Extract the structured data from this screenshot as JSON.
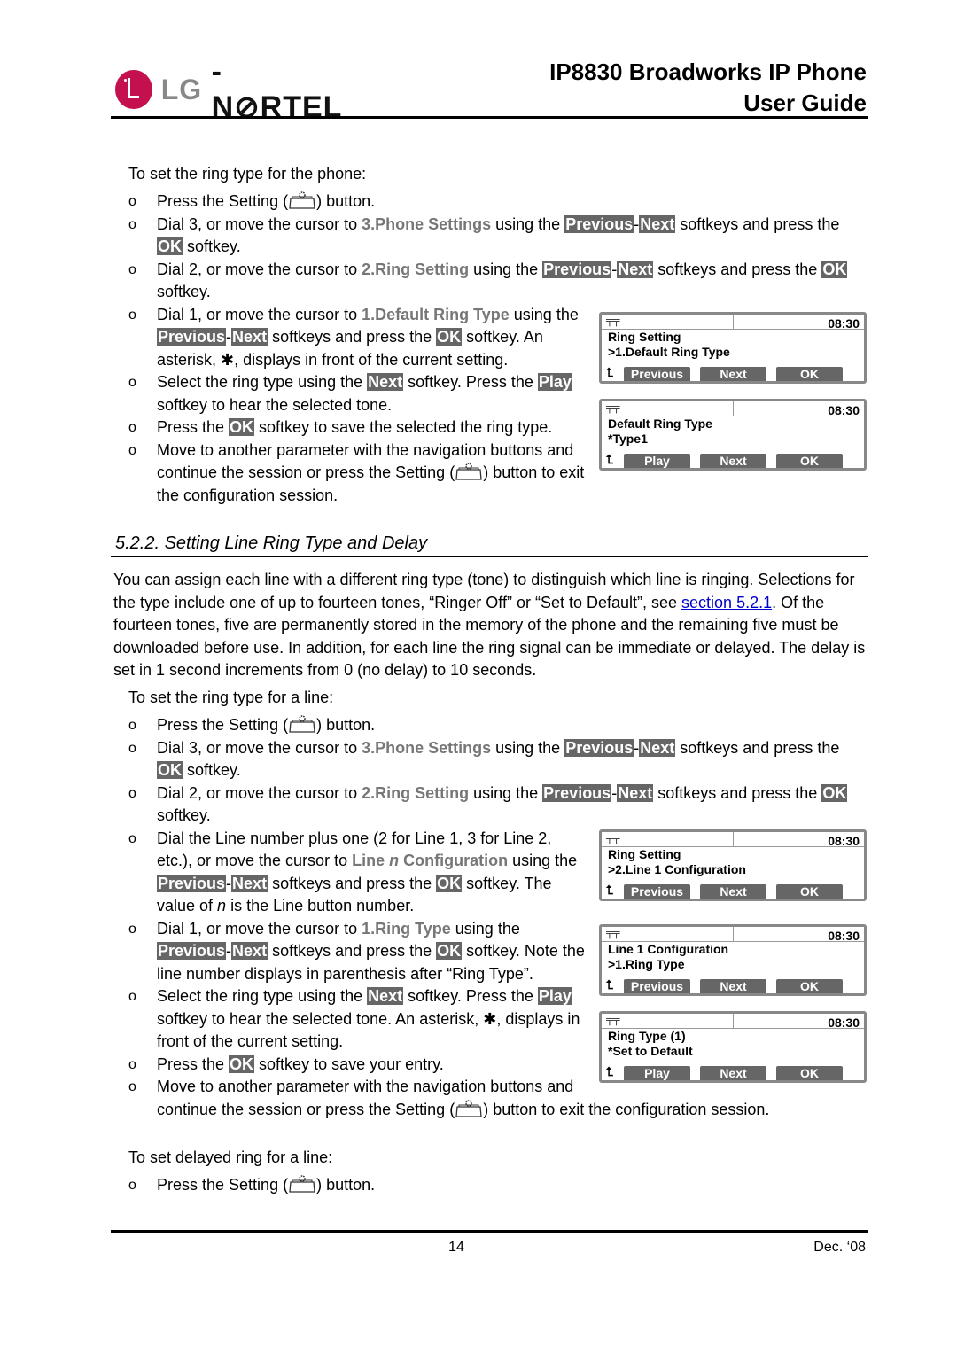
{
  "header": {
    "logo_text": "LG-NORTEL",
    "title_line1": "IP8830 Broadworks IP Phone",
    "title_line2": "User Guide"
  },
  "section1": {
    "intro": "To set the ring type for the phone:",
    "bullets": [
      [
        {
          "t": "Press the Setting ("
        },
        {
          "s": "i"
        },
        {
          "t": ") button."
        }
      ],
      [
        {
          "t": "Dial 3, or move the cursor to "
        },
        {
          "t": "3.Phone Settings",
          "s": "m"
        },
        {
          "t": " using the "
        },
        {
          "t": "Previous",
          "s": "k"
        },
        {
          "t": "-"
        },
        {
          "t": "Next",
          "s": "k"
        },
        {
          "t": " softkeys and press the "
        },
        {
          "t": "OK",
          "s": "k"
        },
        {
          "t": " softkey."
        }
      ],
      [
        {
          "t": "Dial 2, or move the cursor to "
        },
        {
          "t": "2.Ring Setting",
          "s": "m"
        },
        {
          "t": " using the "
        },
        {
          "t": "Previous",
          "s": "k"
        },
        {
          "t": "-"
        },
        {
          "t": "Next",
          "s": "k"
        },
        {
          "t": " softkeys and press the "
        },
        {
          "t": "OK",
          "s": "k"
        },
        {
          "t": " softkey."
        }
      ],
      [
        {
          "t": "Dial 1, or move the cursor to "
        },
        {
          "t": "1.Default Ring Type",
          "s": "m"
        },
        {
          "t": " using the "
        },
        {
          "t": "Previous",
          "s": "k"
        },
        {
          "t": "-"
        },
        {
          "t": "Next",
          "s": "k"
        },
        {
          "t": " softkeys and press the "
        },
        {
          "t": "OK",
          "s": "k"
        },
        {
          "t": " softkey.  An asterisk, "
        },
        {
          "t": "✱"
        },
        {
          "t": ", displays in front of the current setting."
        }
      ],
      [
        {
          "t": "Select the ring type using the "
        },
        {
          "t": "Next",
          "s": "k"
        },
        {
          "t": " softkey.  Press the "
        },
        {
          "t": "Play",
          "s": "k"
        },
        {
          "t": " softkey to hear the selected tone."
        }
      ],
      [
        {
          "t": "Press the "
        },
        {
          "t": "OK",
          "s": "k"
        },
        {
          "t": " softkey to save the selected the ring type."
        }
      ],
      [
        {
          "t": "Move to another parameter with the navigation buttons and continue the session or press the Setting ("
        },
        {
          "s": "i"
        },
        {
          "t": ") button to exit the configuration session."
        }
      ]
    ]
  },
  "section2": {
    "heading": "5.2.2.  Setting Line Ring Type and Delay",
    "paragraph": [
      {
        "t": "You can assign each line with a different ring type (tone) to distinguish which line is ringing.  Selections for the type include one of up to fourteen tones, “Ringer Off” or “Set to Default”, see "
      },
      {
        "t": "section 5.2.1",
        "s": "l"
      },
      {
        "t": ".  Of the fourteen tones, five are permanently stored in the memory of the phone and the remaining five must be downloaded before use.  In addition, for each line the ring signal can be immediate or delayed.  The delay is set in 1 second increments from 0 (no delay) to 10 seconds."
      }
    ],
    "intro": "To set the ring type for a line:",
    "bullets": [
      [
        {
          "t": "Press the Setting ("
        },
        {
          "s": "i"
        },
        {
          "t": ") button."
        }
      ],
      [
        {
          "t": "Dial 3, or move the cursor to "
        },
        {
          "t": "3.Phone Settings",
          "s": "m"
        },
        {
          "t": " using the "
        },
        {
          "t": "Previous",
          "s": "k"
        },
        {
          "t": "-"
        },
        {
          "t": "Next",
          "s": "k"
        },
        {
          "t": " softkeys and press the "
        },
        {
          "t": "OK",
          "s": "k"
        },
        {
          "t": " softkey."
        }
      ],
      [
        {
          "t": "Dial 2, or move the cursor to "
        },
        {
          "t": "2.Ring Setting",
          "s": "m"
        },
        {
          "t": " using the "
        },
        {
          "t": "Previous",
          "s": "k"
        },
        {
          "t": "-"
        },
        {
          "t": "Next",
          "s": "k"
        },
        {
          "t": " softkeys and press the "
        },
        {
          "t": "OK",
          "s": "k"
        },
        {
          "t": " softkey."
        }
      ],
      [
        {
          "t": "Dial the Line number plus one (2 for Line 1, 3 for Line 2, etc.), or move the cursor to "
        },
        {
          "t": "Line ",
          "s": "m"
        },
        {
          "t": "n",
          "s": "mi"
        },
        {
          "t": " Configuration",
          "s": "m"
        },
        {
          "t": " using the "
        },
        {
          "t": "Previous",
          "s": "k"
        },
        {
          "t": "-"
        },
        {
          "t": "Next",
          "s": "k"
        },
        {
          "t": " softkeys and press the "
        },
        {
          "t": "OK",
          "s": "k"
        },
        {
          "t": " softkey. The value of "
        },
        {
          "t": "n",
          "s": "i2"
        },
        {
          "t": " is the Line button number."
        }
      ],
      [
        {
          "t": "Dial 1, or move the cursor to "
        },
        {
          "t": "1.Ring Type",
          "s": "m"
        },
        {
          "t": " using the "
        },
        {
          "t": "Previous",
          "s": "k"
        },
        {
          "t": "-"
        },
        {
          "t": "Next",
          "s": "k"
        },
        {
          "t": " softkeys and press the "
        },
        {
          "t": "OK",
          "s": "k"
        },
        {
          "t": " softkey.  Note the line number displays in parenthesis after “Ring Type”."
        }
      ],
      [
        {
          "t": "Select the ring type using the "
        },
        {
          "t": "Next",
          "s": "k"
        },
        {
          "t": " softkey.  Press the "
        },
        {
          "t": "Play",
          "s": "k"
        },
        {
          "t": " softkey to hear the selected tone.  An asterisk, "
        },
        {
          "t": "✱"
        },
        {
          "t": ", displays in front of the current setting."
        }
      ],
      [
        {
          "t": "Press the "
        },
        {
          "t": "OK",
          "s": "k"
        },
        {
          "t": " softkey to save your entry."
        }
      ],
      [
        {
          "t": "Move to another parameter with the navigation buttons and"
        },
        {
          "s": "br"
        },
        {
          "t": "continue the session or press the Setting ("
        },
        {
          "s": "i"
        },
        {
          "t": ") button to exit the configuration session."
        }
      ]
    ],
    "intro2": "To set delayed ring for a line:",
    "bullets2": [
      [
        {
          "t": "Press the Setting ("
        },
        {
          "s": "i"
        },
        {
          "t": ") button."
        }
      ]
    ]
  },
  "screens": [
    {
      "time": "08:30",
      "line1": "Ring Setting",
      "line2": ">1.Default Ring Type",
      "keys": [
        "Previous",
        "Next",
        "OK"
      ]
    },
    {
      "time": "08:30",
      "line1": "Default Ring Type",
      "line2": "*Type1",
      "keys": [
        "Play",
        "Next",
        "OK"
      ]
    },
    {
      "time": "08:30",
      "line1": "Ring Setting",
      "line2": ">2.Line 1 Configuration",
      "keys": [
        "Previous",
        "Next",
        "OK"
      ]
    },
    {
      "time": "08:30",
      "line1": "Line 1 Configuration",
      "line2": ">1.Ring Type",
      "keys": [
        "Previous",
        "Next",
        "OK"
      ]
    },
    {
      "time": "08:30",
      "line1": "Ring Type (1)",
      "line2": "*Set to Default",
      "keys": [
        "Play",
        "Next",
        "OK"
      ]
    }
  ],
  "footer": {
    "page": "14",
    "date": "Dec. ‘08"
  }
}
